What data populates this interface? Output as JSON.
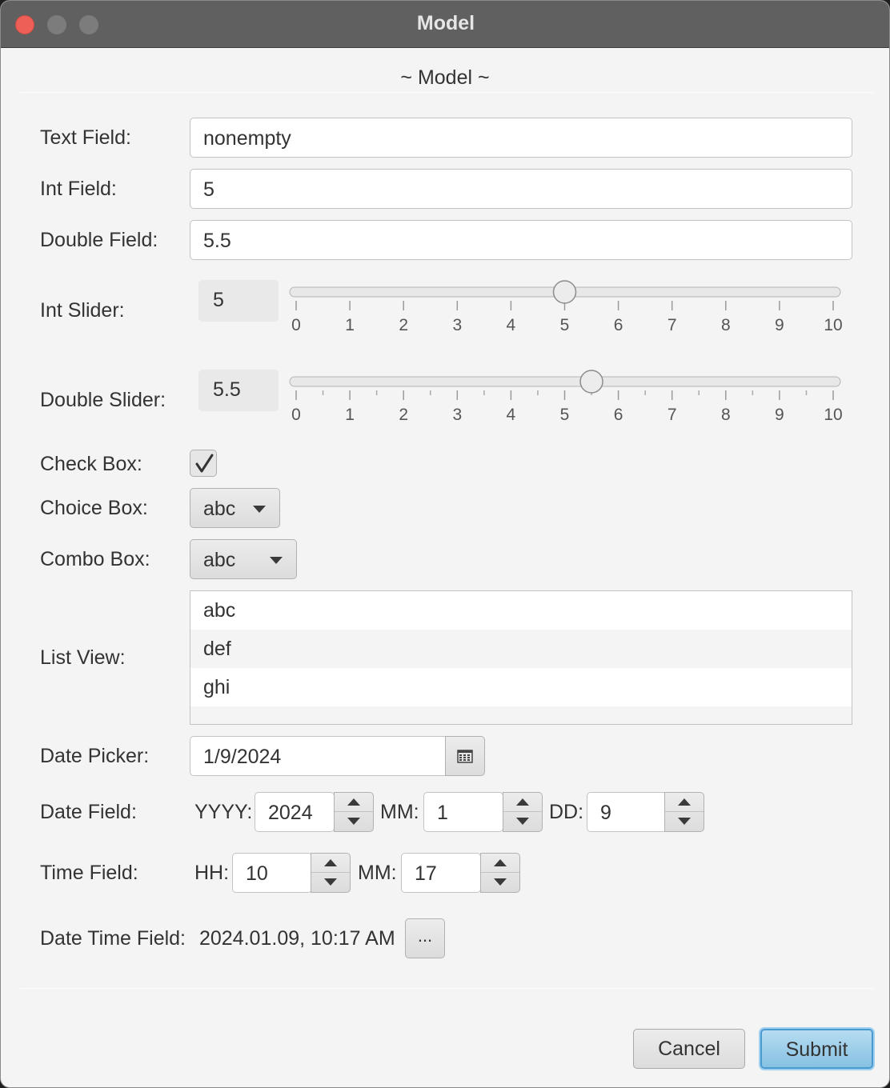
{
  "window": {
    "title": "Model",
    "header": "~ Model ~"
  },
  "form": {
    "text_field": {
      "label": "Text Field:",
      "value": "nonempty"
    },
    "int_field": {
      "label": "Int Field:",
      "value": "5"
    },
    "double_field": {
      "label": "Double Field:",
      "value": "5.5"
    },
    "int_slider": {
      "label": "Int Slider:",
      "value_text": "5",
      "value": 5,
      "min": 0,
      "max": 10,
      "tick_labels": [
        "0",
        "1",
        "2",
        "3",
        "4",
        "5",
        "6",
        "7",
        "8",
        "9",
        "10"
      ]
    },
    "double_slider": {
      "label": "Double Slider:",
      "value_text": "5.5",
      "value": 5.5,
      "min": 0,
      "max": 10,
      "tick_labels": [
        "0",
        "1",
        "2",
        "3",
        "4",
        "5",
        "6",
        "7",
        "8",
        "9",
        "10"
      ]
    },
    "check_box": {
      "label": "Check Box:",
      "checked": true
    },
    "choice_box": {
      "label": "Choice Box:",
      "value": "abc"
    },
    "combo_box": {
      "label": "Combo Box:",
      "value": "abc"
    },
    "list_view": {
      "label": "List View:",
      "items": [
        "abc",
        "def",
        "ghi"
      ]
    },
    "date_picker": {
      "label": "Date Picker:",
      "value": "1/9/2024"
    },
    "date_field": {
      "label": "Date Field:",
      "year_label": "YYYY:",
      "year": "2024",
      "month_label": "MM:",
      "month": "1",
      "day_label": "DD:",
      "day": "9"
    },
    "time_field": {
      "label": "Time Field:",
      "hour_label": "HH:",
      "hour": "10",
      "minute_label": "MM:",
      "minute": "17"
    },
    "date_time_field": {
      "label": "Date Time Field:",
      "value": "2024.01.09, 10:17 AM",
      "button_label": "..."
    }
  },
  "buttons": {
    "cancel": "Cancel",
    "submit": "Submit"
  },
  "colors": {
    "accent": "#86c1e3",
    "titlebar": "#5f605f",
    "close": "#ee5f57"
  }
}
